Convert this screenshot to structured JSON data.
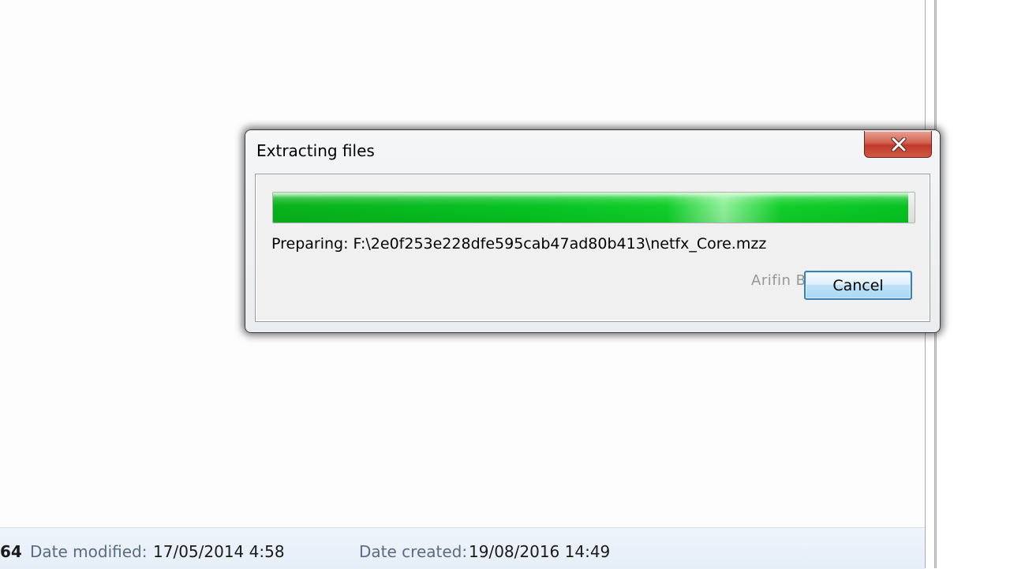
{
  "dialog": {
    "title": "Extracting files",
    "progress_percent": 99,
    "status_text": "Preparing: F:\\2e0f253e228dfe595cab47ad80b413\\netfx_Core.mzz",
    "cancel_label": "Cancel",
    "close_icon": "close-icon",
    "watermark": "Arifin Berbagi Tutorial"
  },
  "details_pane": {
    "size_fragment": "64",
    "date_modified_label": "Date modified:",
    "date_modified_value": "17/05/2014 4:58",
    "date_created_label": "Date created:",
    "date_created_value": "19/08/2016 14:49"
  },
  "colors": {
    "progress_green": "#06c322",
    "close_red": "#c0392b",
    "cancel_border": "#3c7fb1",
    "details_label": "#5a6b80"
  }
}
